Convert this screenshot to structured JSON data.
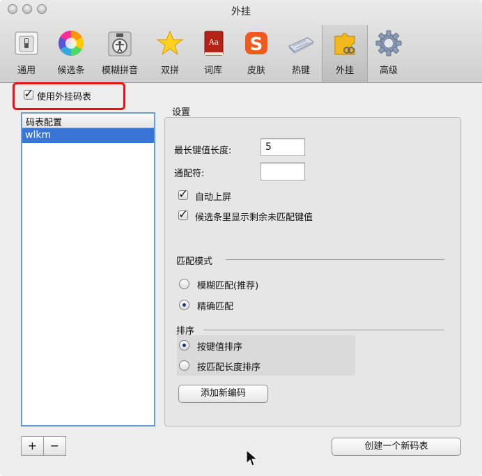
{
  "window": {
    "title": "外挂"
  },
  "toolbar": {
    "items": [
      {
        "label": "通用",
        "icon": "switch-icon"
      },
      {
        "label": "候选条",
        "icon": "color-wheel-icon"
      },
      {
        "label": "模糊拼音",
        "icon": "accessibility-icon"
      },
      {
        "label": "双拼",
        "icon": "star-icon"
      },
      {
        "label": "词库",
        "icon": "dictionary-icon"
      },
      {
        "label": "皮肤",
        "icon": "sogou-logo-icon"
      },
      {
        "label": "热键",
        "icon": "keyboard-icon"
      },
      {
        "label": "外挂",
        "icon": "puzzle-icon",
        "selected": true
      },
      {
        "label": "高级",
        "icon": "gear-icon"
      }
    ]
  },
  "use_plugin": {
    "label": "使用外挂码表",
    "checked": true
  },
  "table_list": {
    "header": "码表配置",
    "rows": [
      "wlkm"
    ],
    "selected_index": 0
  },
  "list_buttons": {
    "add": "+",
    "remove": "−"
  },
  "settings": {
    "group_title": "设置",
    "max_key_len": {
      "label": "最长键值长度:",
      "value": "5"
    },
    "wildcard": {
      "label": "通配符:",
      "value": ""
    },
    "auto_commit": {
      "label": "自动上屏",
      "checked": true
    },
    "show_remaining": {
      "label": "候选条里显示剩余未匹配键值",
      "checked": true
    },
    "match_mode": {
      "title": "匹配模式",
      "fuzzy": {
        "label": "模糊匹配(推荐)",
        "selected": false
      },
      "exact": {
        "label": "精确匹配",
        "selected": true
      }
    },
    "sort": {
      "title": "排序",
      "by_key": {
        "label": "按键值排序",
        "selected": true
      },
      "by_length": {
        "label": "按匹配长度排序",
        "selected": false
      }
    },
    "add_code_button": "添加新编码"
  },
  "new_table_button": "创建一个新码表",
  "colors": {
    "accent": "#3875d7",
    "highlight_red": "#ee1111"
  }
}
